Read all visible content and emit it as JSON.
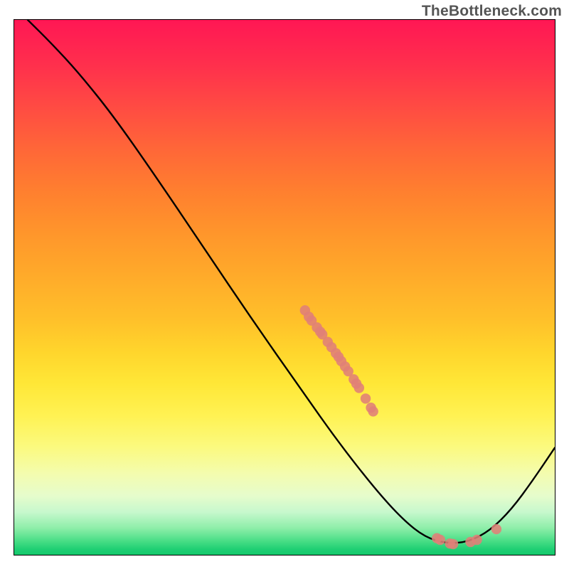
{
  "attribution": "TheBottleneck.com",
  "chart_data": {
    "type": "line",
    "title": "",
    "xlabel": "",
    "ylabel": "",
    "xlim": [
      0,
      100
    ],
    "ylim": [
      0,
      100
    ],
    "curve": [
      {
        "x": 2.5,
        "y": 100
      },
      {
        "x": 7,
        "y": 95.5
      },
      {
        "x": 12,
        "y": 90
      },
      {
        "x": 18,
        "y": 82.5
      },
      {
        "x": 26,
        "y": 71
      },
      {
        "x": 35,
        "y": 57.5
      },
      {
        "x": 44,
        "y": 44
      },
      {
        "x": 53,
        "y": 31
      },
      {
        "x": 60,
        "y": 21
      },
      {
        "x": 67,
        "y": 12
      },
      {
        "x": 72,
        "y": 6.5
      },
      {
        "x": 76,
        "y": 3.3
      },
      {
        "x": 80,
        "y": 2.1
      },
      {
        "x": 84,
        "y": 2.4
      },
      {
        "x": 88,
        "y": 4.5
      },
      {
        "x": 92,
        "y": 8.5
      },
      {
        "x": 96,
        "y": 14
      },
      {
        "x": 100,
        "y": 20
      }
    ],
    "points": [
      {
        "x": 53.8,
        "y": 45.7
      },
      {
        "x": 54.5,
        "y": 44.5
      },
      {
        "x": 55.0,
        "y": 43.8
      },
      {
        "x": 56.0,
        "y": 42.5
      },
      {
        "x": 56.6,
        "y": 41.7
      },
      {
        "x": 57.0,
        "y": 41.2
      },
      {
        "x": 58.0,
        "y": 39.8
      },
      {
        "x": 58.7,
        "y": 38.8
      },
      {
        "x": 59.5,
        "y": 37.7
      },
      {
        "x": 60.0,
        "y": 37.0
      },
      {
        "x": 60.5,
        "y": 36.2
      },
      {
        "x": 61.2,
        "y": 35.2
      },
      {
        "x": 61.8,
        "y": 34.3
      },
      {
        "x": 62.8,
        "y": 32.8
      },
      {
        "x": 63.3,
        "y": 32.0
      },
      {
        "x": 63.8,
        "y": 31.2
      },
      {
        "x": 65.0,
        "y": 29.2
      },
      {
        "x": 66.0,
        "y": 27.5
      },
      {
        "x": 66.4,
        "y": 26.8
      },
      {
        "x": 78.2,
        "y": 3.1
      },
      {
        "x": 78.8,
        "y": 2.8
      },
      {
        "x": 80.6,
        "y": 2.1
      },
      {
        "x": 81.2,
        "y": 2.0
      },
      {
        "x": 84.4,
        "y": 2.4
      },
      {
        "x": 85.6,
        "y": 2.8
      },
      {
        "x": 89.2,
        "y": 4.8
      }
    ],
    "series": [
      {
        "name": "bottleneck-curve",
        "color": "#000000"
      },
      {
        "name": "data-points",
        "color": "#e08078"
      }
    ]
  }
}
